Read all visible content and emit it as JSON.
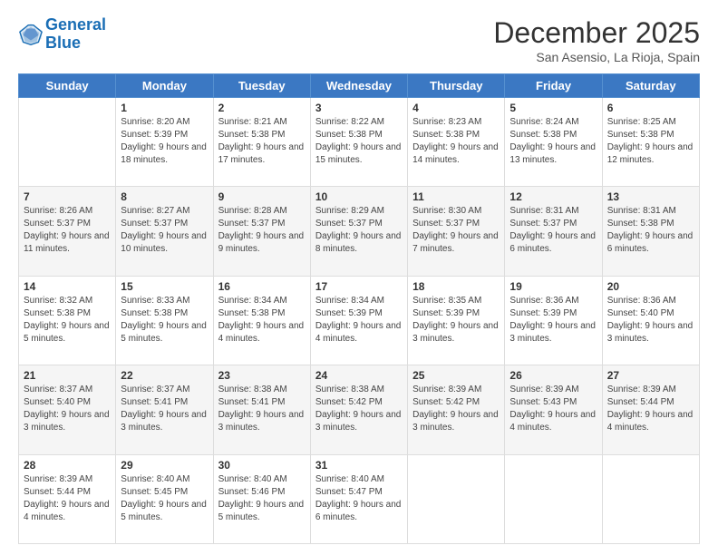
{
  "logo": {
    "line1": "General",
    "line2": "Blue"
  },
  "header": {
    "month": "December 2025",
    "location": "San Asensio, La Rioja, Spain"
  },
  "days_of_week": [
    "Sunday",
    "Monday",
    "Tuesday",
    "Wednesday",
    "Thursday",
    "Friday",
    "Saturday"
  ],
  "weeks": [
    [
      {
        "day": "",
        "sunrise": "",
        "sunset": "",
        "daylight": ""
      },
      {
        "day": "1",
        "sunrise": "Sunrise: 8:20 AM",
        "sunset": "Sunset: 5:39 PM",
        "daylight": "Daylight: 9 hours and 18 minutes."
      },
      {
        "day": "2",
        "sunrise": "Sunrise: 8:21 AM",
        "sunset": "Sunset: 5:38 PM",
        "daylight": "Daylight: 9 hours and 17 minutes."
      },
      {
        "day": "3",
        "sunrise": "Sunrise: 8:22 AM",
        "sunset": "Sunset: 5:38 PM",
        "daylight": "Daylight: 9 hours and 15 minutes."
      },
      {
        "day": "4",
        "sunrise": "Sunrise: 8:23 AM",
        "sunset": "Sunset: 5:38 PM",
        "daylight": "Daylight: 9 hours and 14 minutes."
      },
      {
        "day": "5",
        "sunrise": "Sunrise: 8:24 AM",
        "sunset": "Sunset: 5:38 PM",
        "daylight": "Daylight: 9 hours and 13 minutes."
      },
      {
        "day": "6",
        "sunrise": "Sunrise: 8:25 AM",
        "sunset": "Sunset: 5:38 PM",
        "daylight": "Daylight: 9 hours and 12 minutes."
      }
    ],
    [
      {
        "day": "7",
        "sunrise": "Sunrise: 8:26 AM",
        "sunset": "Sunset: 5:37 PM",
        "daylight": "Daylight: 9 hours and 11 minutes."
      },
      {
        "day": "8",
        "sunrise": "Sunrise: 8:27 AM",
        "sunset": "Sunset: 5:37 PM",
        "daylight": "Daylight: 9 hours and 10 minutes."
      },
      {
        "day": "9",
        "sunrise": "Sunrise: 8:28 AM",
        "sunset": "Sunset: 5:37 PM",
        "daylight": "Daylight: 9 hours and 9 minutes."
      },
      {
        "day": "10",
        "sunrise": "Sunrise: 8:29 AM",
        "sunset": "Sunset: 5:37 PM",
        "daylight": "Daylight: 9 hours and 8 minutes."
      },
      {
        "day": "11",
        "sunrise": "Sunrise: 8:30 AM",
        "sunset": "Sunset: 5:37 PM",
        "daylight": "Daylight: 9 hours and 7 minutes."
      },
      {
        "day": "12",
        "sunrise": "Sunrise: 8:31 AM",
        "sunset": "Sunset: 5:37 PM",
        "daylight": "Daylight: 9 hours and 6 minutes."
      },
      {
        "day": "13",
        "sunrise": "Sunrise: 8:31 AM",
        "sunset": "Sunset: 5:38 PM",
        "daylight": "Daylight: 9 hours and 6 minutes."
      }
    ],
    [
      {
        "day": "14",
        "sunrise": "Sunrise: 8:32 AM",
        "sunset": "Sunset: 5:38 PM",
        "daylight": "Daylight: 9 hours and 5 minutes."
      },
      {
        "day": "15",
        "sunrise": "Sunrise: 8:33 AM",
        "sunset": "Sunset: 5:38 PM",
        "daylight": "Daylight: 9 hours and 5 minutes."
      },
      {
        "day": "16",
        "sunrise": "Sunrise: 8:34 AM",
        "sunset": "Sunset: 5:38 PM",
        "daylight": "Daylight: 9 hours and 4 minutes."
      },
      {
        "day": "17",
        "sunrise": "Sunrise: 8:34 AM",
        "sunset": "Sunset: 5:39 PM",
        "daylight": "Daylight: 9 hours and 4 minutes."
      },
      {
        "day": "18",
        "sunrise": "Sunrise: 8:35 AM",
        "sunset": "Sunset: 5:39 PM",
        "daylight": "Daylight: 9 hours and 3 minutes."
      },
      {
        "day": "19",
        "sunrise": "Sunrise: 8:36 AM",
        "sunset": "Sunset: 5:39 PM",
        "daylight": "Daylight: 9 hours and 3 minutes."
      },
      {
        "day": "20",
        "sunrise": "Sunrise: 8:36 AM",
        "sunset": "Sunset: 5:40 PM",
        "daylight": "Daylight: 9 hours and 3 minutes."
      }
    ],
    [
      {
        "day": "21",
        "sunrise": "Sunrise: 8:37 AM",
        "sunset": "Sunset: 5:40 PM",
        "daylight": "Daylight: 9 hours and 3 minutes."
      },
      {
        "day": "22",
        "sunrise": "Sunrise: 8:37 AM",
        "sunset": "Sunset: 5:41 PM",
        "daylight": "Daylight: 9 hours and 3 minutes."
      },
      {
        "day": "23",
        "sunrise": "Sunrise: 8:38 AM",
        "sunset": "Sunset: 5:41 PM",
        "daylight": "Daylight: 9 hours and 3 minutes."
      },
      {
        "day": "24",
        "sunrise": "Sunrise: 8:38 AM",
        "sunset": "Sunset: 5:42 PM",
        "daylight": "Daylight: 9 hours and 3 minutes."
      },
      {
        "day": "25",
        "sunrise": "Sunrise: 8:39 AM",
        "sunset": "Sunset: 5:42 PM",
        "daylight": "Daylight: 9 hours and 3 minutes."
      },
      {
        "day": "26",
        "sunrise": "Sunrise: 8:39 AM",
        "sunset": "Sunset: 5:43 PM",
        "daylight": "Daylight: 9 hours and 4 minutes."
      },
      {
        "day": "27",
        "sunrise": "Sunrise: 8:39 AM",
        "sunset": "Sunset: 5:44 PM",
        "daylight": "Daylight: 9 hours and 4 minutes."
      }
    ],
    [
      {
        "day": "28",
        "sunrise": "Sunrise: 8:39 AM",
        "sunset": "Sunset: 5:44 PM",
        "daylight": "Daylight: 9 hours and 4 minutes."
      },
      {
        "day": "29",
        "sunrise": "Sunrise: 8:40 AM",
        "sunset": "Sunset: 5:45 PM",
        "daylight": "Daylight: 9 hours and 5 minutes."
      },
      {
        "day": "30",
        "sunrise": "Sunrise: 8:40 AM",
        "sunset": "Sunset: 5:46 PM",
        "daylight": "Daylight: 9 hours and 5 minutes."
      },
      {
        "day": "31",
        "sunrise": "Sunrise: 8:40 AM",
        "sunset": "Sunset: 5:47 PM",
        "daylight": "Daylight: 9 hours and 6 minutes."
      },
      {
        "day": "",
        "sunrise": "",
        "sunset": "",
        "daylight": ""
      },
      {
        "day": "",
        "sunrise": "",
        "sunset": "",
        "daylight": ""
      },
      {
        "day": "",
        "sunrise": "",
        "sunset": "",
        "daylight": ""
      }
    ]
  ]
}
